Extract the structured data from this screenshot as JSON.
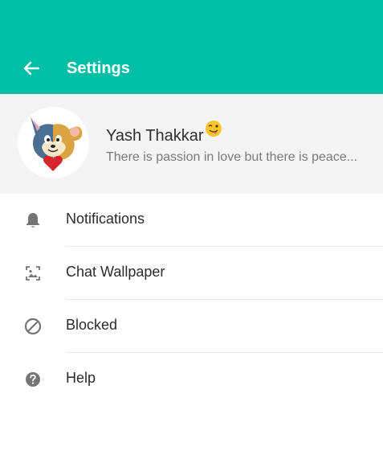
{
  "header": {
    "title": "Settings",
    "back_icon": "arrow-back-icon",
    "color": "#00bfa5"
  },
  "profile": {
    "name": "Yash Thakkar",
    "name_emoji": "😜",
    "status": "There is passion in love but there is peace...",
    "avatar_icon": "tom-and-jerry-avatar-icon"
  },
  "menu": {
    "items": [
      {
        "label": "Notifications",
        "icon": "bell-icon"
      },
      {
        "label": "Chat Wallpaper",
        "icon": "wallpaper-icon"
      },
      {
        "label": "Blocked",
        "icon": "block-icon"
      },
      {
        "label": "Help",
        "icon": "help-icon"
      }
    ]
  }
}
